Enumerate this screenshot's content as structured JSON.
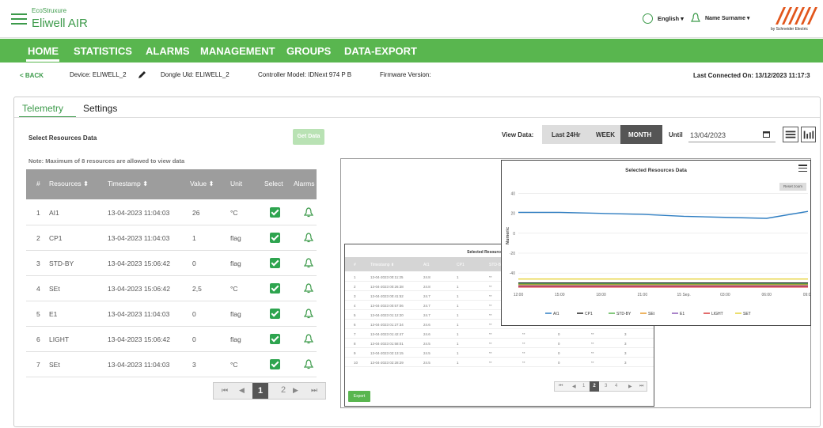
{
  "header": {
    "brand_line": "EcoStruxure",
    "app_name": "Eliwell AIR",
    "language": "English ▾",
    "user": "Name Surname ▾",
    "logo_word": "eliwell",
    "logo_sub": "by Schneider Electric"
  },
  "nav": {
    "items": [
      "HOME",
      "STATISTICS",
      "ALARMS",
      "MANAGEMENT",
      "GROUPS",
      "DATA-EXPORT"
    ],
    "active": "HOME"
  },
  "info_bar": {
    "back": "< BACK",
    "device": "Device: ELIWELL_2",
    "dongle": "Dongle Uld: ELIWELL_2",
    "controller": "Controller Model: IDNext 974 P B",
    "firmware": "Firmware Version:",
    "last_connected": "Last Connected On: 13/12/2023 11:17:3"
  },
  "tabs": [
    "Telemetry",
    "Settings"
  ],
  "resources": {
    "title": "Select Resources Data",
    "get_data": "Get Data",
    "note": "Note: Maximum of 8 resources are allowed to view data",
    "columns": [
      "#",
      "Resources ⬍",
      "Timestamp ⬍",
      "Value ⬍",
      "Unit",
      "Select",
      "Alarms"
    ],
    "rows": [
      {
        "n": "1",
        "name": "AI1",
        "ts": "13-04-2023 11:04:03",
        "value": "26",
        "unit": "°C"
      },
      {
        "n": "2",
        "name": "CP1",
        "ts": "13-04-2023 11:04:03",
        "value": "1",
        "unit": "flag"
      },
      {
        "n": "3",
        "name": "STD-BY",
        "ts": "13-04-2023 15:06:42",
        "value": "0",
        "unit": "flag"
      },
      {
        "n": "4",
        "name": "SEt",
        "ts": "13-04-2023 15:06:42",
        "value": "2,5",
        "unit": "°C"
      },
      {
        "n": "5",
        "name": "E1",
        "ts": "13-04-2023 11:04:03",
        "value": "0",
        "unit": "flag"
      },
      {
        "n": "6",
        "name": "LIGHT",
        "ts": "13-04-2023 15:06:42",
        "value": "0",
        "unit": "flag"
      },
      {
        "n": "7",
        "name": "SEt",
        "ts": "13-04-2023 11:04:03",
        "value": "3",
        "unit": "°C"
      }
    ],
    "pager": {
      "first": "⏮",
      "prev": "◀",
      "page1": "1",
      "page2": "2",
      "next": "▶",
      "last": "⏭"
    }
  },
  "view_data": {
    "label": "View Data:",
    "options": [
      "Last 24Hr",
      "WEEK",
      "MONTH"
    ],
    "selected": "MONTH",
    "until_label": "Until",
    "until_date": "13/04/2023"
  },
  "data_table": {
    "title": "Selected Resources Data",
    "columns": [
      "#",
      "Timestamp ⬍",
      "AI1",
      "CP1",
      "STD-B"
    ],
    "rows": [
      [
        "1",
        "13-04-2023 00:11:25",
        "24.8",
        "1",
        "**",
        "**",
        "0",
        "**",
        "3"
      ],
      [
        "2",
        "13-04-2023 00:26:38",
        "24.8",
        "1",
        "**",
        "**",
        "0",
        "**",
        "3"
      ],
      [
        "3",
        "13-04-2023 00:41:52",
        "24.7",
        "1",
        "**",
        "**",
        "0",
        "**",
        "3"
      ],
      [
        "4",
        "13-04-2023 00:57:06",
        "24.7",
        "1",
        "**",
        "**",
        "0",
        "**",
        "3"
      ],
      [
        "5",
        "13-04-2023 01:12:20",
        "24.7",
        "1",
        "**",
        "**",
        "0",
        "**",
        "3"
      ],
      [
        "6",
        "13-04-2023 01:27:34",
        "24.6",
        "1",
        "**",
        "**",
        "0",
        "**",
        "3"
      ],
      [
        "7",
        "13-04-2023 01:42:47",
        "24.6",
        "1",
        "**",
        "**",
        "0",
        "**",
        "3"
      ],
      [
        "8",
        "13-04-2023 01:58:01",
        "24.5",
        "1",
        "**",
        "**",
        "0",
        "**",
        "3"
      ],
      [
        "9",
        "13-04-2023 02:13:15",
        "24.5",
        "1",
        "**",
        "**",
        "0",
        "**",
        "3"
      ],
      [
        "10",
        "13-04-2023 02:28:29",
        "24.5",
        "1",
        "**",
        "**",
        "0",
        "**",
        "3"
      ]
    ],
    "pager": [
      "⏮",
      "◀",
      "1",
      "2",
      "3",
      "4",
      "▶",
      "⏭"
    ],
    "export": "Export"
  },
  "chart_data": {
    "type": "line",
    "title": "Selected Resources Data",
    "reset_label": "Reset zoom",
    "ylabel": "Numeric",
    "ylim": [
      -55,
      50
    ],
    "yticks": [
      40,
      20,
      0,
      -20,
      -40
    ],
    "xticks": [
      "12:00",
      "15:00",
      "18:00",
      "21:00",
      "15 Sep.",
      "03:00",
      "06:00",
      "09:00"
    ],
    "x": [
      0,
      1,
      2,
      3,
      4,
      5,
      6,
      7
    ],
    "series": [
      {
        "name": "AI1",
        "color": "#2f7ec2",
        "values": [
          21,
          21,
          20,
          19,
          17,
          16,
          15,
          22
        ]
      },
      {
        "name": "CP1",
        "color": "#222222",
        "values": [
          -50,
          -50,
          -50,
          -50,
          -50,
          -50,
          -50,
          -50
        ]
      },
      {
        "name": "STD-BY",
        "color": "#59b64f",
        "values": [
          -51,
          -51,
          -51,
          -51,
          -51,
          -51,
          -51,
          -51
        ]
      },
      {
        "name": "SEt",
        "color": "#e89a2c",
        "values": [
          -52,
          -52,
          -52,
          -52,
          -52,
          -52,
          -52,
          -52
        ]
      },
      {
        "name": "E1",
        "color": "#8e5bb8",
        "values": [
          -53,
          -53,
          -53,
          -53,
          -53,
          -53,
          -53,
          -53
        ]
      },
      {
        "name": "LIGHT",
        "color": "#d83a3a",
        "values": [
          -54,
          -54,
          -54,
          -54,
          -54,
          -54,
          -54,
          -54
        ]
      },
      {
        "name": "SET",
        "color": "#e6d33a",
        "values": [
          -46,
          -46,
          -46,
          -46,
          -46,
          -46,
          -46,
          -46
        ]
      }
    ],
    "grid": true,
    "legend": "bottom"
  }
}
